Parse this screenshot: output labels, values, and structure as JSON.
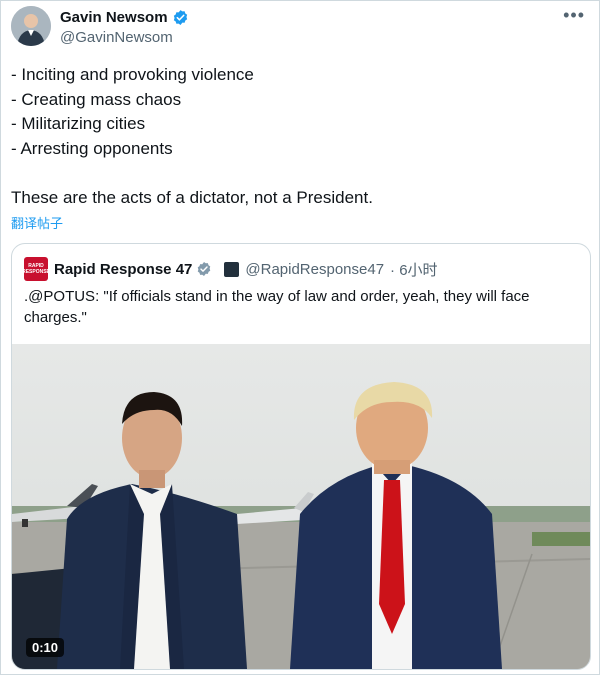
{
  "tweet": {
    "author_name": "Gavin Newsom",
    "author_handle": "@GavinNewsom",
    "lines": [
      "- Inciting and provoking violence",
      "- Creating mass chaos",
      "- Militarizing cities",
      "- Arresting opponents"
    ],
    "closing": "These are the acts of a dictator, not a President.",
    "translate_label": "翻译帖子",
    "more_label": "•••"
  },
  "quote": {
    "avatar_text": "RAPID RESPONSE",
    "author_name": "Rapid Response 47",
    "author_handle": "@RapidResponse47",
    "time": "· 6小时",
    "text": ".@POTUS: \"If officials stand in the way of law and order, yeah, they will face charges.\"",
    "video_duration": "0:10"
  },
  "colors": {
    "verified_blue": "#1d9bf0",
    "verified_gray": "#829aab",
    "link_blue": "#1d9bf0",
    "brand_red": "#c8102e"
  },
  "icons": {
    "verified": "verified-badge-icon",
    "more": "more-options-icon",
    "affiliate": "affiliate-badge-icon"
  }
}
